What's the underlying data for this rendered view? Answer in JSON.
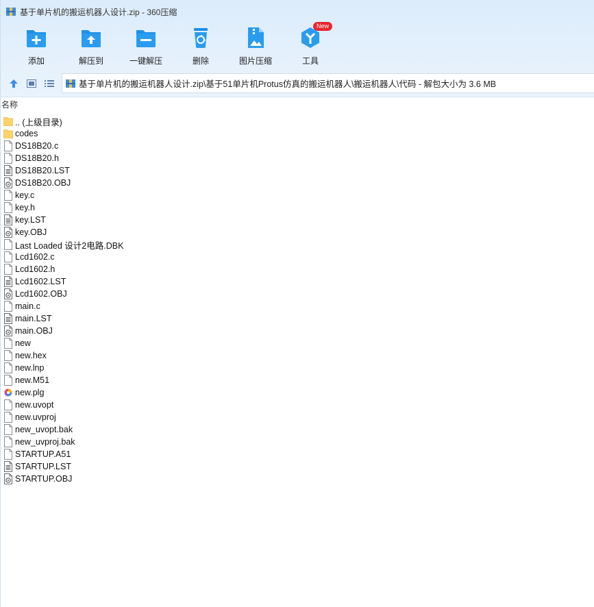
{
  "window": {
    "title": "基于单片机的搬运机器人设计.zip - 360压缩"
  },
  "toolbar": [
    {
      "label": "添加",
      "icon": "add-icon"
    },
    {
      "label": "解压到",
      "icon": "extract-to-icon"
    },
    {
      "label": "一键解压",
      "icon": "one-click-extract-icon"
    },
    {
      "label": "删除",
      "icon": "delete-icon"
    },
    {
      "label": "图片压缩",
      "icon": "image-compress-icon"
    },
    {
      "label": "工具",
      "icon": "tools-icon",
      "badge": "New"
    }
  ],
  "address": {
    "path": "基于单片机的搬运机器人设计.zip\\基于51单片机Protus仿真的搬运机器人\\搬运机器人\\代码 - 解包大小为 3.6 MB"
  },
  "list": {
    "column_name": "名称",
    "items": [
      {
        "name": ".. (上级目录)",
        "type": "folder"
      },
      {
        "name": "codes",
        "type": "folder"
      },
      {
        "name": "DS18B20.c",
        "type": "file"
      },
      {
        "name": "DS18B20.h",
        "type": "file"
      },
      {
        "name": "DS18B20.LST",
        "type": "text"
      },
      {
        "name": "DS18B20.OBJ",
        "type": "obj"
      },
      {
        "name": "key.c",
        "type": "file"
      },
      {
        "name": "key.h",
        "type": "file"
      },
      {
        "name": "key.LST",
        "type": "text"
      },
      {
        "name": "key.OBJ",
        "type": "obj"
      },
      {
        "name": "Last Loaded 设计2电路.DBK",
        "type": "file"
      },
      {
        "name": "Lcd1602.c",
        "type": "file"
      },
      {
        "name": "Lcd1602.h",
        "type": "file"
      },
      {
        "name": "Lcd1602.LST",
        "type": "text"
      },
      {
        "name": "Lcd1602.OBJ",
        "type": "obj"
      },
      {
        "name": "main.c",
        "type": "file"
      },
      {
        "name": "main.LST",
        "type": "text"
      },
      {
        "name": "main.OBJ",
        "type": "obj"
      },
      {
        "name": "new",
        "type": "file"
      },
      {
        "name": "new.hex",
        "type": "file"
      },
      {
        "name": "new.lnp",
        "type": "file"
      },
      {
        "name": "new.M51",
        "type": "file"
      },
      {
        "name": "new.plg",
        "type": "plg"
      },
      {
        "name": "new.uvopt",
        "type": "file"
      },
      {
        "name": "new.uvproj",
        "type": "file"
      },
      {
        "name": "new_uvopt.bak",
        "type": "file"
      },
      {
        "name": "new_uvproj.bak",
        "type": "file"
      },
      {
        "name": "STARTUP.A51",
        "type": "file"
      },
      {
        "name": "STARTUP.LST",
        "type": "text"
      },
      {
        "name": "STARTUP.OBJ",
        "type": "obj"
      }
    ]
  },
  "colors": {
    "accent": "#1e90e8",
    "folder": "#ffd36b",
    "badge": "#e8262e"
  }
}
